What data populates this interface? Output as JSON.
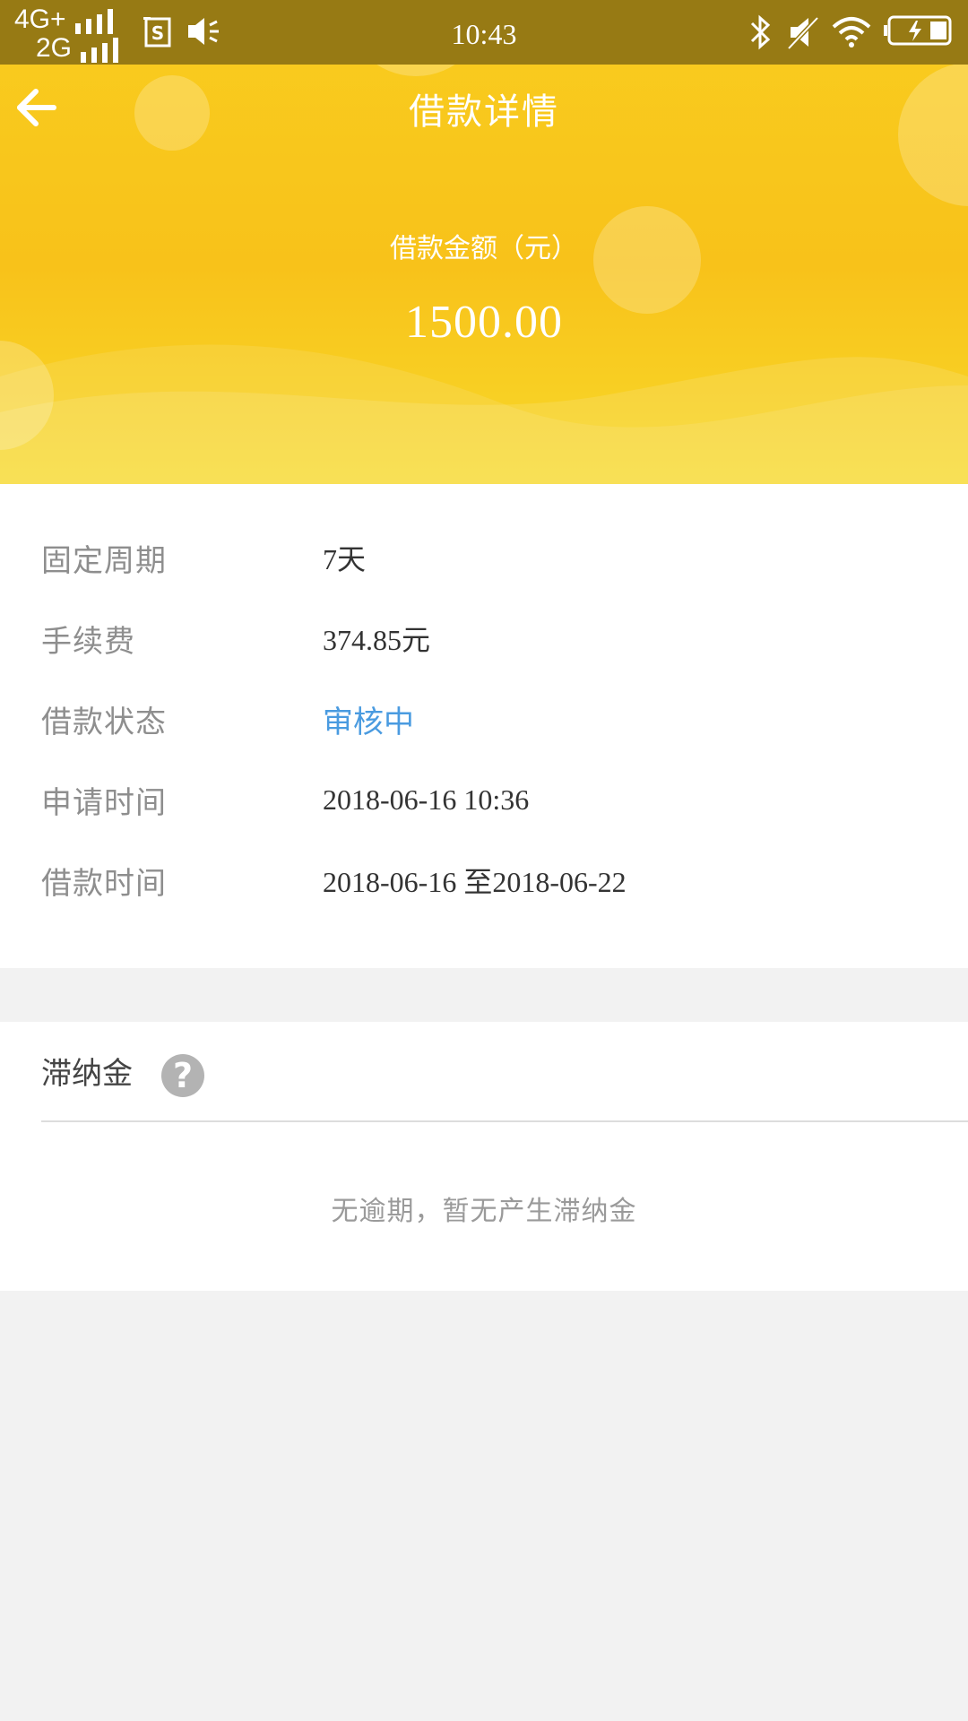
{
  "status_bar": {
    "network_primary": "4G+",
    "network_secondary": "2G",
    "time": "10:43",
    "icons": [
      "signal-icon",
      "screenshot-icon",
      "volume-icon",
      "bluetooth-icon",
      "mute-icon",
      "wifi-icon",
      "battery-charging-icon"
    ]
  },
  "header": {
    "title": "借款详情",
    "amount_label": "借款金额（元）",
    "amount_value": "1500.00",
    "back_icon": "arrow-left-icon"
  },
  "details": {
    "rows": [
      {
        "label": "固定周期",
        "value": "7天"
      },
      {
        "label": "手续费",
        "value": "374.85元"
      },
      {
        "label": "借款状态",
        "value": "审核中"
      },
      {
        "label": "申请时间",
        "value": "2018-06-16 10:36"
      },
      {
        "label": "借款时间",
        "value": "2018-06-16 至2018-06-22"
      }
    ]
  },
  "late_fee": {
    "title": "滞纳金",
    "help_icon": "question-circle-icon",
    "help_glyph": "?",
    "empty_message": "无逾期，暂无产生滞纳金"
  },
  "colors": {
    "status_bar": "#977a14",
    "header_yellow": "#f8c21a",
    "status_accent": "#4a9be0",
    "background": "#f2f2f2"
  }
}
